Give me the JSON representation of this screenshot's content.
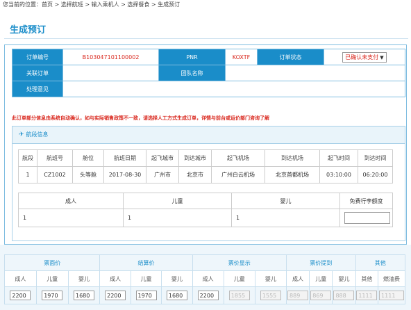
{
  "breadcrumb": "您当前的位置：首页 > 选择航班 > 输入乘机人 > 选择餐食 > 生成预订",
  "page_title": "生成预订",
  "order": {
    "order_no_label": "订单编号",
    "order_no": "B103047101100002",
    "pnr_label": "PNR",
    "pnr": "KOXTF",
    "status_label": "订单状态",
    "status": "已确认未支付",
    "linked_label": "关联订单",
    "group_label": "团队名称",
    "comment_label": "处理意见"
  },
  "warning": "此订单部分信息由系统自动确认，如与实际销售政策不一致，请选择人工方式生成订单，详情与前台或运价部门咨询了解",
  "segment": {
    "heading": "航段信息",
    "headers": [
      "航段",
      "航班号",
      "舱位",
      "航班日期",
      "起飞城市",
      "到达城市",
      "起飞机场",
      "到达机场",
      "起飞时间",
      "到达时间"
    ],
    "row": [
      "1",
      "CZ1002",
      "头等舱",
      "2017-08-30",
      "广州市",
      "北京市",
      "广州白云机场",
      "北京首都机场",
      "03:10:00",
      "06:20:00"
    ]
  },
  "passengers": {
    "headers": [
      "成人",
      "儿童",
      "婴儿",
      "免费行李额度"
    ],
    "values": [
      "1",
      "1",
      "1"
    ]
  },
  "price": {
    "groups": [
      "票面价",
      "结算价",
      "票价显示",
      "票价提到",
      "其他"
    ],
    "sub": [
      "成人",
      "儿童",
      "婴儿",
      "成人",
      "儿童",
      "婴儿",
      "成人",
      "儿童",
      "婴儿",
      "成人",
      "儿童",
      "婴儿",
      "其他",
      "燃油费"
    ],
    "values": [
      "2200",
      "1970",
      "1680",
      "2200",
      "1970",
      "1680",
      "2200",
      "1855",
      "1555",
      "889",
      "869",
      "888",
      "1111",
      "1111"
    ]
  }
}
